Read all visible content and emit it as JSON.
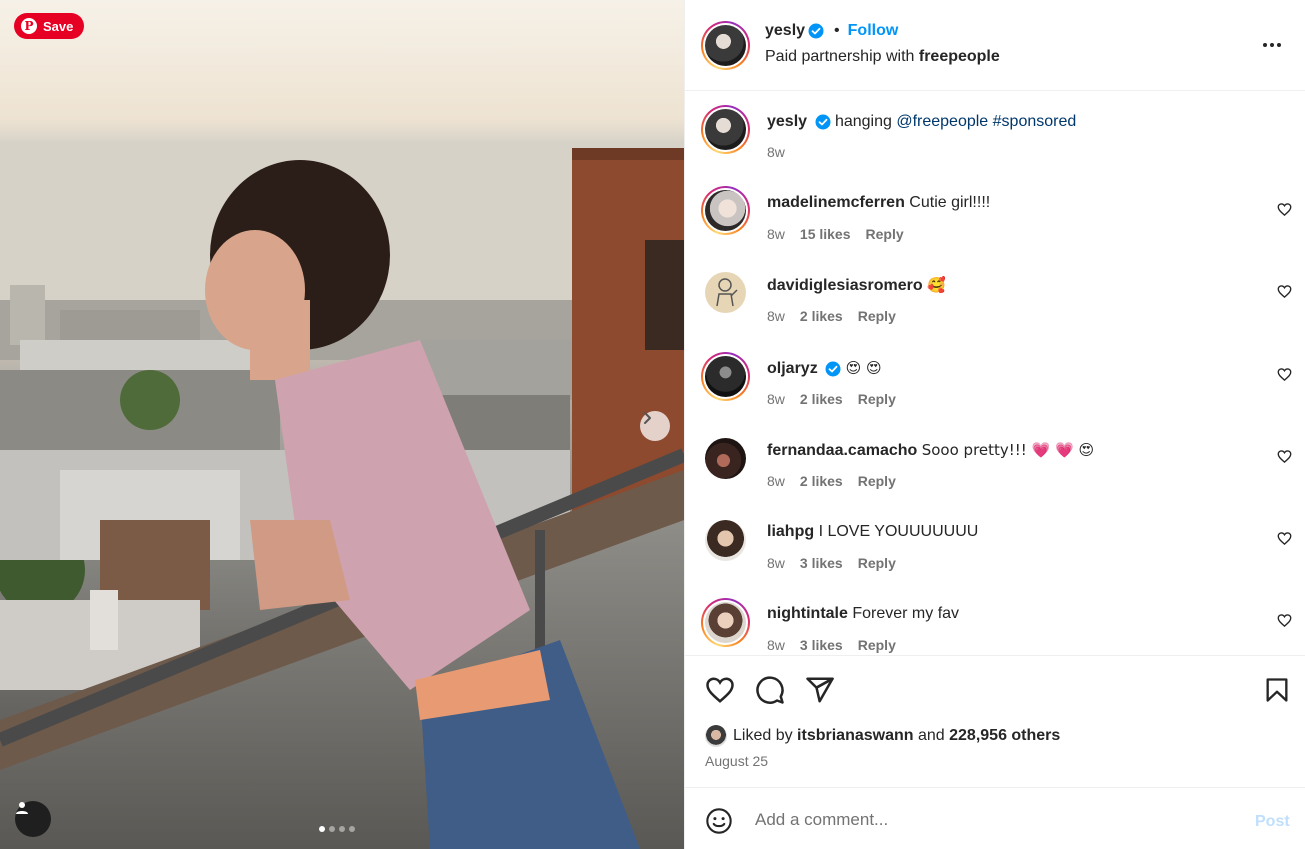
{
  "photo": {
    "save_label": "Save",
    "carousel_count": 4,
    "carousel_active": 1
  },
  "header": {
    "username": "yesly",
    "separator": "•",
    "follow_label": "Follow",
    "subtitle_prefix": "Paid partnership with ",
    "partner": "freepeople"
  },
  "caption": {
    "username": "yesly",
    "text_plain": "hanging ",
    "mention": "@freepeople",
    "hashtag": "#sponsored",
    "time": "8w"
  },
  "comments": [
    {
      "username": "madelinemcferren",
      "text": "Cutie girl!!!!",
      "time": "8w",
      "likes": "15 likes",
      "reply": "Reply",
      "ring": true,
      "verified": false
    },
    {
      "username": "davidiglesiasromero",
      "text": "🥰",
      "time": "8w",
      "likes": "2 likes",
      "reply": "Reply",
      "ring": false,
      "verified": false
    },
    {
      "username": "oljaryz",
      "text": "😍 😍",
      "time": "8w",
      "likes": "2 likes",
      "reply": "Reply",
      "ring": true,
      "verified": true
    },
    {
      "username": "fernandaa.camacho",
      "text": "Sooo pretty!!! 💗 💗 😍",
      "time": "8w",
      "likes": "2 likes",
      "reply": "Reply",
      "ring": false,
      "verified": false
    },
    {
      "username": "liahpg",
      "text": "I LOVE YOUUUUUUU",
      "time": "8w",
      "likes": "3 likes",
      "reply": "Reply",
      "ring": false,
      "verified": false
    },
    {
      "username": "nightintale",
      "text": "Forever my fav",
      "time": "8w",
      "likes": "3 likes",
      "reply": "Reply",
      "ring": true,
      "verified": false
    }
  ],
  "likes": {
    "prefix": "Liked by ",
    "user": "itsbrianaswann",
    "middle": " and ",
    "others": "228,956 others"
  },
  "date": "August 25",
  "add_comment": {
    "placeholder": "Add a comment...",
    "post_label": "Post"
  },
  "colors": {
    "accent": "#0095f6",
    "verified": "#0095f6",
    "pinterest": "#e60023",
    "muted": "#737373",
    "link": "#00376b"
  },
  "icons": [
    "pinterest-icon",
    "chevron-right-icon",
    "user-tag-icon",
    "verified-icon",
    "more-icon",
    "heart-icon",
    "comment-icon",
    "share-icon",
    "bookmark-icon",
    "emoji-icon"
  ]
}
